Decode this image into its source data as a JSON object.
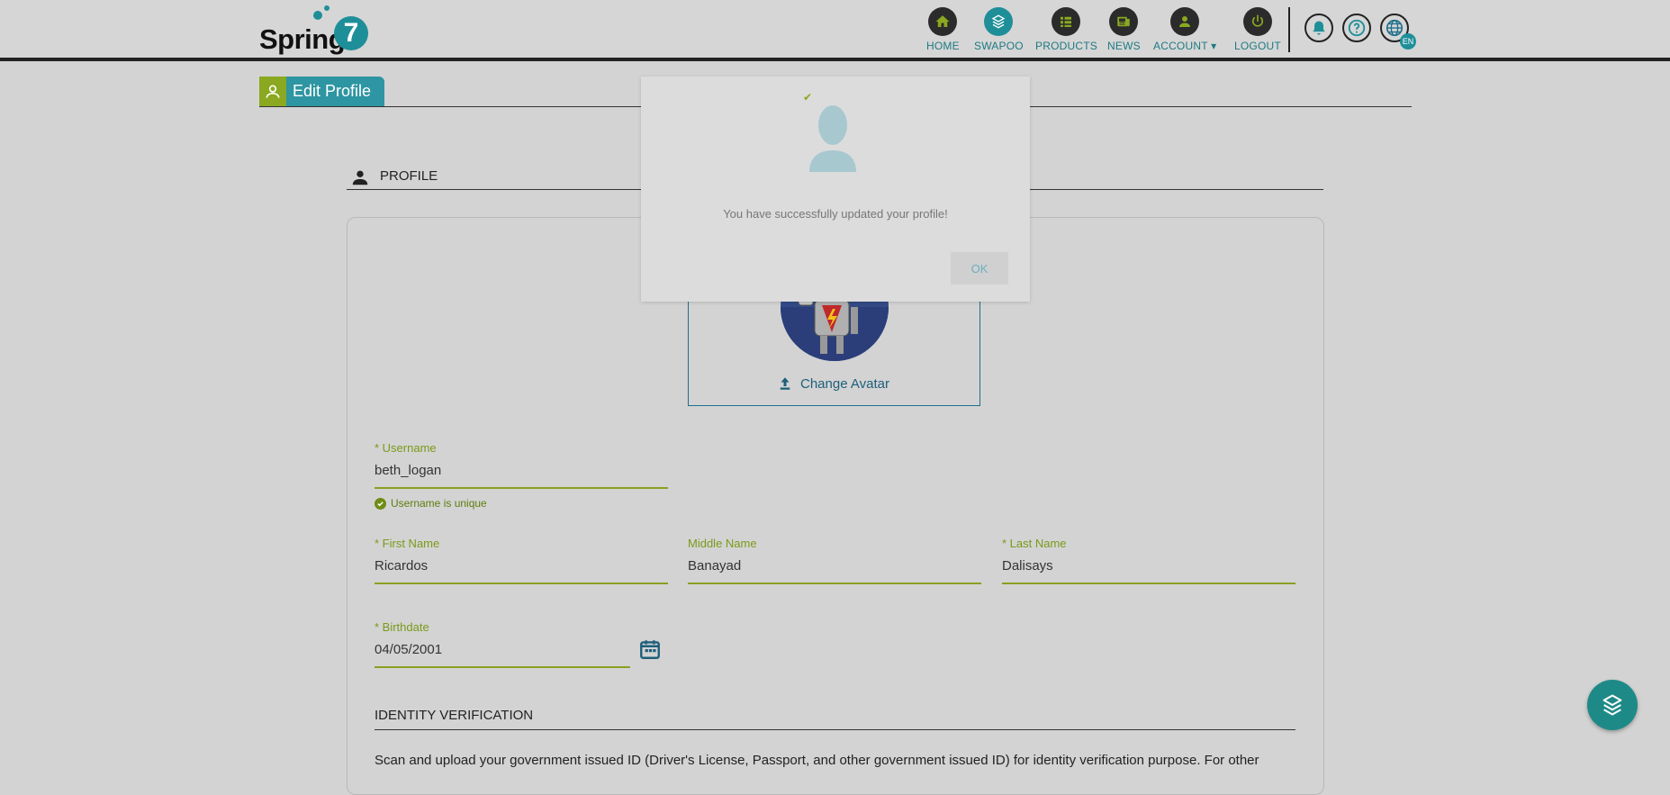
{
  "header": {
    "logo_text": "Spring",
    "logo_number": "7",
    "nav": [
      {
        "label": "HOME",
        "icon": "home-icon"
      },
      {
        "label": "SWAPOO",
        "icon": "swapoo-icon"
      },
      {
        "label": "PRODUCTS",
        "icon": "products-icon"
      },
      {
        "label": "NEWS",
        "icon": "news-icon"
      },
      {
        "label": "ACCOUNT",
        "icon": "account-icon"
      },
      {
        "label": "LOGOUT",
        "icon": "power-icon"
      }
    ],
    "language_badge": "EN"
  },
  "page_tab": {
    "label": "Edit Profile"
  },
  "profile_section": {
    "title": "PROFILE",
    "change_avatar_label": "Change Avatar",
    "username": {
      "label": "* Username",
      "value": "beth_logan",
      "hint": "Username is unique"
    },
    "first_name": {
      "label": "* First Name",
      "value": "Ricardos"
    },
    "middle_name": {
      "label": "Middle Name",
      "value": "Banayad"
    },
    "last_name": {
      "label": "* Last Name",
      "value": "Dalisays"
    },
    "birthdate": {
      "label": "* Birthdate",
      "value": "04/05/2001"
    },
    "identity_title": "IDENTITY VERIFICATION",
    "identity_desc": "Scan and upload your government issued ID (Driver's License, Passport, and other government issued ID) for identity verification purpose. For other"
  },
  "modal": {
    "message": "You have successfully updated your profile!",
    "ok_label": "OK"
  },
  "colors": {
    "teal": "#1e8f99",
    "green": "#8aa820",
    "dark": "#2b2b2b"
  }
}
